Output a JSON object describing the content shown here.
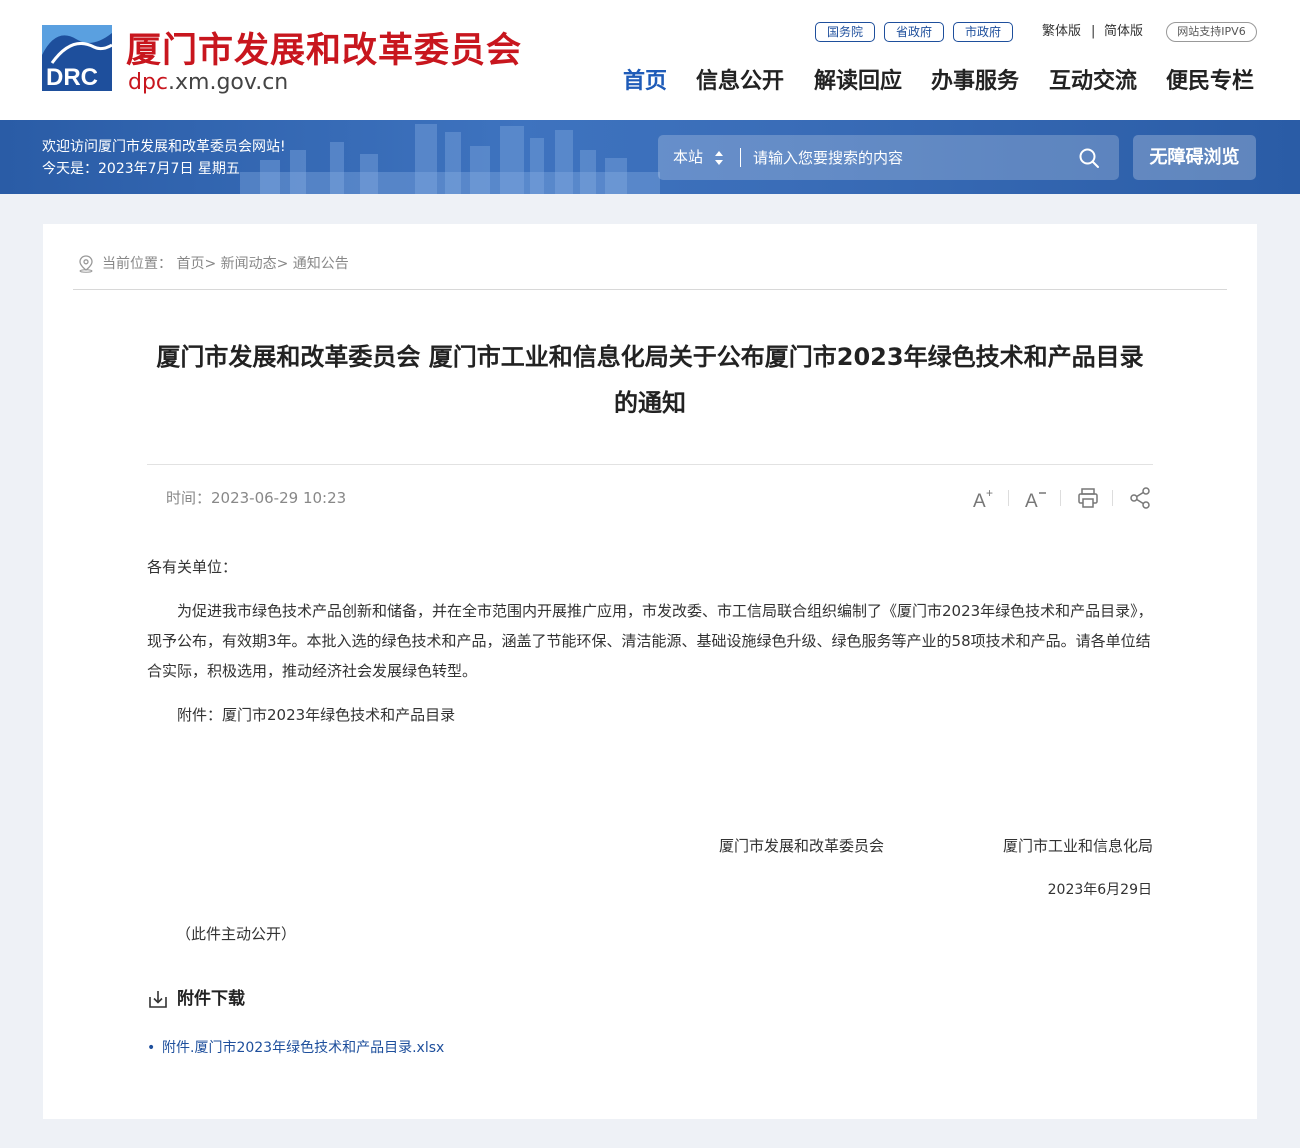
{
  "header": {
    "site_name": "厦门市发展和改革委员会",
    "domain_highlight": "dpc",
    "domain_rest": ".xm.gov.cn",
    "logo_text": "DRC",
    "gov_links": [
      "国务院",
      "省政府",
      "市政府"
    ],
    "lang_traditional": "繁体版",
    "lang_separator": "|",
    "lang_simplified": "简体版",
    "ipv6_badge": "网站支持IPV6",
    "nav": [
      "首页",
      "信息公开",
      "解读回应",
      "办事服务",
      "互动交流",
      "便民专栏"
    ],
    "active_nav": "首页"
  },
  "banner": {
    "welcome": "欢迎访问厦门市发展和改革委员会网站!",
    "today": "今天是：2023年7月7日 星期五",
    "search_scope": "本站",
    "search_placeholder": "请输入您要搜索的内容",
    "accessibility_button": "无障碍浏览"
  },
  "article": {
    "breadcrumb": "当前位置： 首页> 新闻动态> 通知公告",
    "title": "厦门市发展和改革委员会 厦门市工业和信息化局关于公布厦门市2023年绿色技术和产品目录的通知",
    "publish_time": "时间：2023-06-29 10:23",
    "salutation": "各有关单位：",
    "paragraph": "为促进我市绿色技术产品创新和储备，并在全市范围内开展推广应用，市发改委、市工信局联合组织编制了《厦门市2023年绿色技术和产品目录》，现予公布，有效期3年。本批入选的绿色技术和产品，涵盖了节能环保、清洁能源、基础设施绿色升级、绿色服务等产业的58项技术和产品。请各单位结合实际，积极选用，推动经济社会发展绿色转型。",
    "attachment_line": "附件：厦门市2023年绿色技术和产品目录",
    "signer_1": "厦门市发展和改革委员会",
    "signer_2": "厦门市工业和信息化局",
    "sign_date": "2023年6月29日",
    "public_note": "（此件主动公开）",
    "download_title": "附件下载",
    "download_item_bullet": "•",
    "download_item": "附件.厦门市2023年绿色技术和产品目录.xlsx"
  },
  "colors": {
    "brand_red": "#c8161e",
    "brand_blue": "#1e4f9c",
    "nav_active": "#1e5bb8",
    "banner_blue": "#3e73bf",
    "page_bg": "#eef1f6"
  },
  "icons": [
    "location-pin-icon",
    "search-icon",
    "font-increase-icon",
    "font-decrease-icon",
    "print-icon",
    "share-icon",
    "download-icon",
    "sort-arrows-icon"
  ]
}
